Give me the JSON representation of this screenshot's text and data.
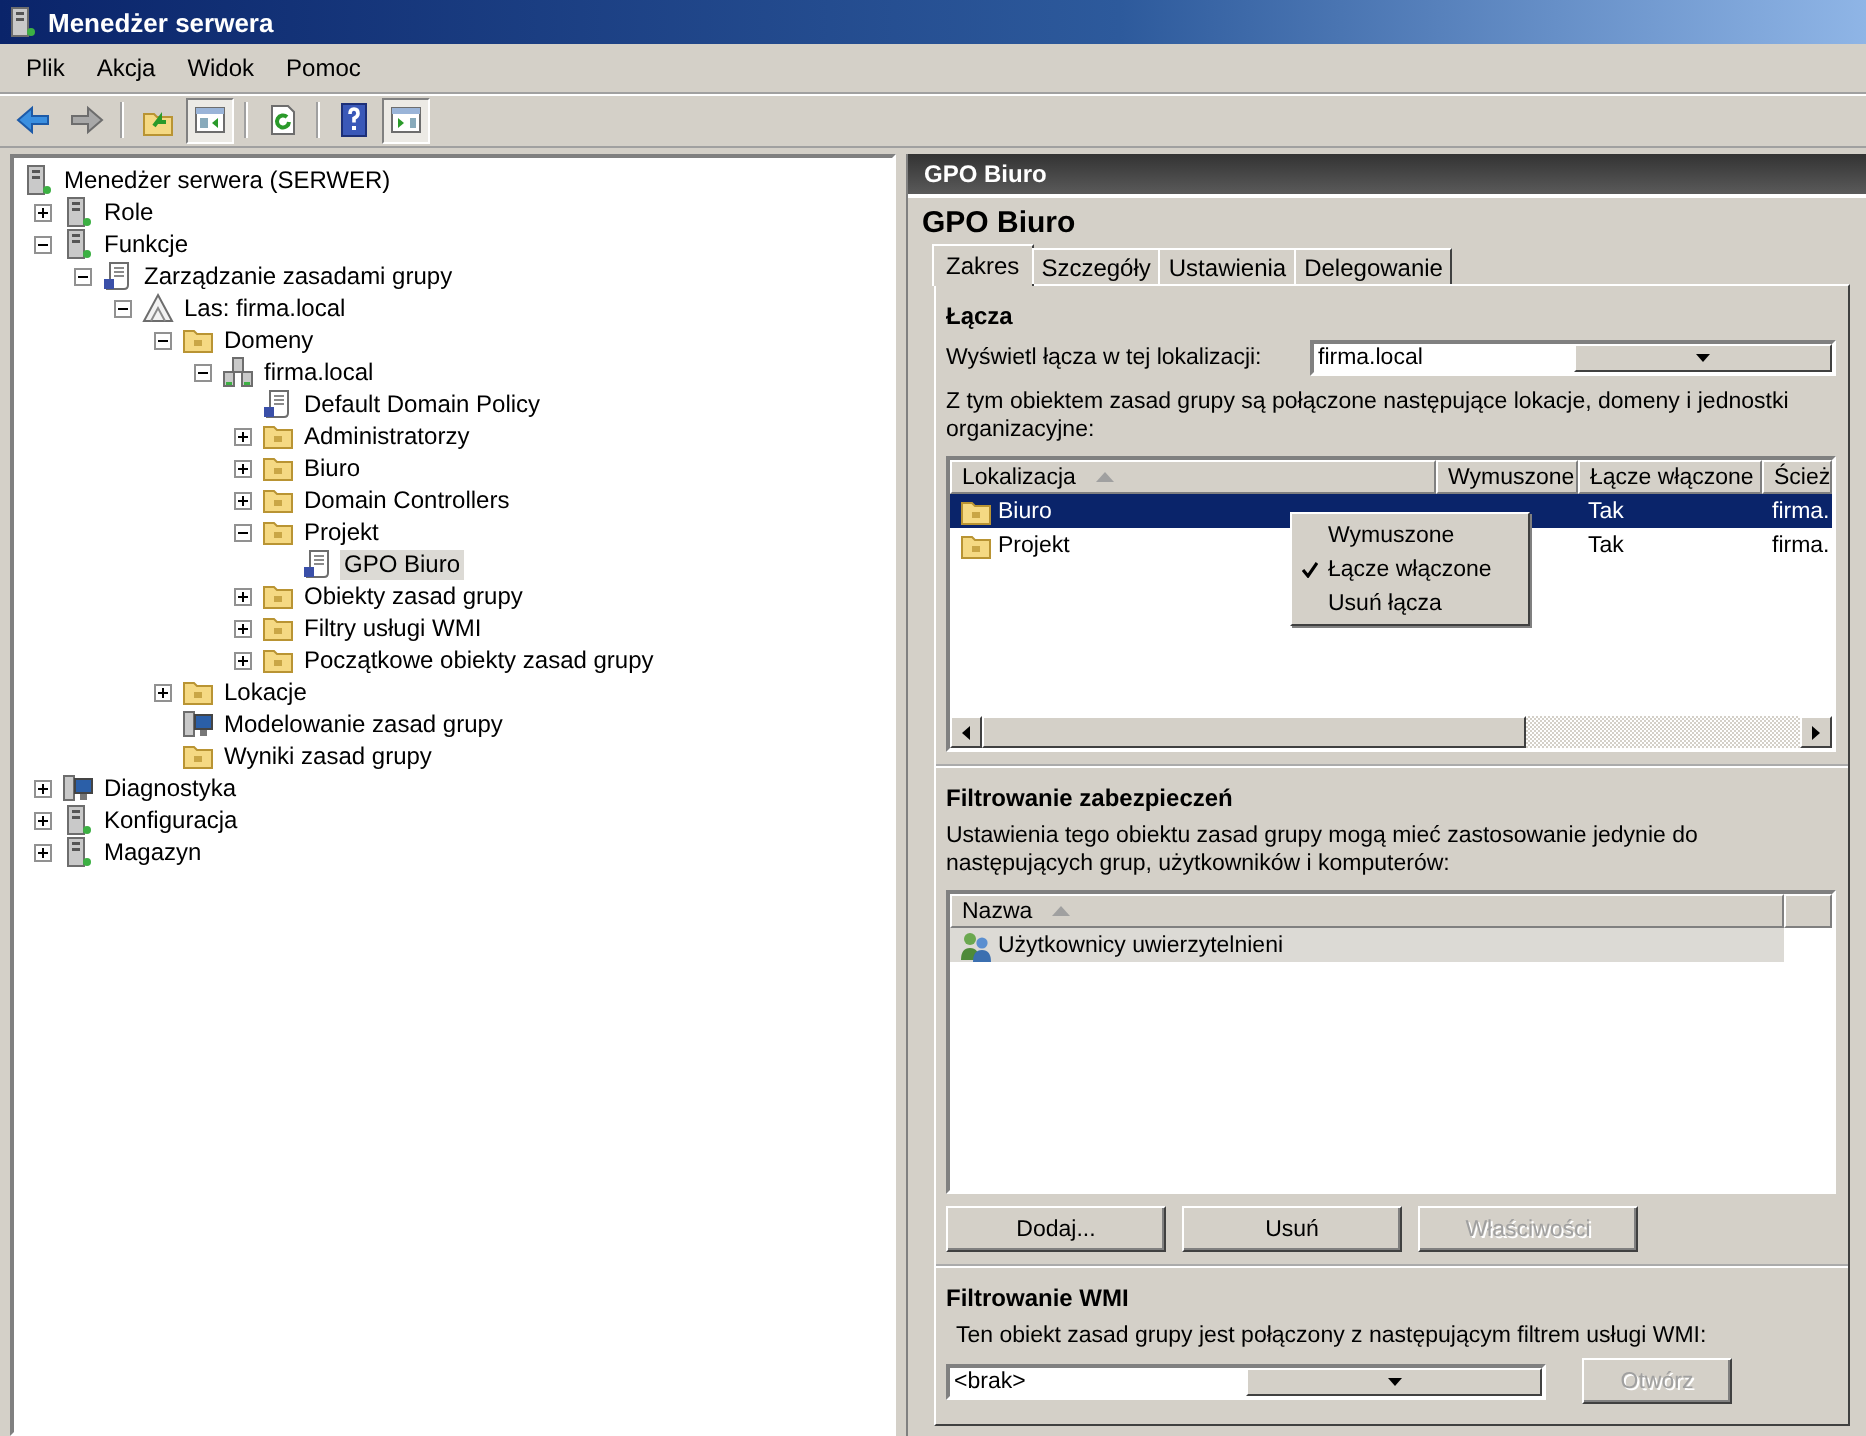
{
  "window": {
    "title": "Menedżer serwera"
  },
  "menu": [
    "Plik",
    "Akcja",
    "Widok",
    "Pomoc"
  ],
  "toolbar": [
    [
      {
        "kind": "back",
        "pressed": false
      },
      {
        "kind": "forward",
        "pressed": false
      }
    ],
    [
      {
        "kind": "up",
        "pressed": false
      },
      {
        "kind": "tree-pane",
        "pressed": true
      }
    ],
    [
      {
        "kind": "refresh",
        "pressed": false
      }
    ],
    [
      {
        "kind": "help",
        "pressed": false
      },
      {
        "kind": "action-pane",
        "pressed": true
      }
    ]
  ],
  "tree": {
    "root": {
      "label": "Menedżer serwera (SERWER)",
      "kind": "server",
      "selected": false
    },
    "items": [
      {
        "label": "Role",
        "kind": "server",
        "expanded": false,
        "selected": false
      },
      {
        "label": "Funkcje",
        "kind": "server",
        "expanded": true,
        "selected": false,
        "children": [
          {
            "label": "Zarządzanie zasadami grupy",
            "kind": "document",
            "expanded": true,
            "selected": false,
            "children": [
              {
                "label": "Las: firma.local",
                "kind": "forest",
                "expanded": true,
                "selected": false,
                "children": [
                  {
                    "label": "Domeny",
                    "kind": "folder",
                    "expanded": true,
                    "selected": false,
                    "children": [
                      {
                        "label": "firma.local",
                        "kind": "domain",
                        "expanded": true,
                        "selected": false,
                        "children": [
                          {
                            "label": "Default Domain Policy",
                            "kind": "document",
                            "selected": false
                          },
                          {
                            "label": "Administratorzy",
                            "kind": "folder",
                            "expanded": false,
                            "selected": false
                          },
                          {
                            "label": "Biuro",
                            "kind": "folder",
                            "expanded": false,
                            "selected": false
                          },
                          {
                            "label": "Domain Controllers",
                            "kind": "folder",
                            "expanded": false,
                            "selected": false
                          },
                          {
                            "label": "Projekt",
                            "kind": "folder",
                            "expanded": true,
                            "selected": false,
                            "children": [
                              {
                                "label": "GPO Biuro",
                                "kind": "document",
                                "selected": true
                              }
                            ]
                          },
                          {
                            "label": "Obiekty zasad grupy",
                            "kind": "folder",
                            "expanded": false,
                            "selected": false
                          },
                          {
                            "label": "Filtry usługi WMI",
                            "kind": "folder",
                            "expanded": false,
                            "selected": false
                          },
                          {
                            "label": "Początkowe obiekty zasad grupy",
                            "kind": "folder",
                            "expanded": false,
                            "selected": false
                          }
                        ]
                      }
                    ]
                  },
                  {
                    "label": "Lokacje",
                    "kind": "folder",
                    "expanded": false,
                    "selected": false
                  },
                  {
                    "label": "Modelowanie zasad grupy",
                    "kind": "monitor",
                    "selected": false
                  },
                  {
                    "label": "Wyniki zasad grupy",
                    "kind": "folder",
                    "selected": false
                  }
                ]
              }
            ]
          }
        ]
      },
      {
        "label": "Diagnostyka",
        "kind": "monitor",
        "expanded": false,
        "selected": false
      },
      {
        "label": "Konfiguracja",
        "kind": "server",
        "expanded": false,
        "selected": false
      },
      {
        "label": "Magazyn",
        "kind": "server",
        "expanded": false,
        "selected": false
      }
    ]
  },
  "details": {
    "header": "GPO Biuro",
    "title": "GPO Biuro",
    "tabs": [
      {
        "label": "Zakres",
        "selected": true
      },
      {
        "label": "Szczegóły",
        "selected": false
      },
      {
        "label": "Ustawienia",
        "selected": false
      },
      {
        "label": "Delegowanie",
        "selected": false
      }
    ],
    "links": {
      "heading": "Łącza",
      "location_label": "Wyświetl łącza w tej lokalizacji:",
      "location_value": "firma.local",
      "description": "Z tym obiektem zasad grupy są połączone następujące lokacje, domeny i jednostki organizacyjne:",
      "columns": [
        {
          "label": "Lokalizacja",
          "sorted": true
        },
        {
          "label": "Wymuszone",
          "sorted": false
        },
        {
          "label": "Łącze włączone",
          "sorted": false
        },
        {
          "label": "Ścież",
          "sorted": false
        }
      ],
      "rows": [
        {
          "location": "Biuro",
          "link_enabled": "Tak",
          "path": "firma.",
          "selected": true
        },
        {
          "location": "Projekt",
          "link_enabled": "Tak",
          "path": "firma.",
          "selected": false
        }
      ],
      "context_menu": [
        {
          "label": "Wymuszone",
          "checked": false
        },
        {
          "label": "Łącze włączone",
          "checked": true
        },
        {
          "label": "Usuń łącza",
          "checked": false
        }
      ]
    },
    "security": {
      "heading": "Filtrowanie zabezpieczeń",
      "description": "Ustawienia tego obiektu zasad grupy mogą mieć zastosowanie jedynie do następujących grup, użytkowników i komputerów:",
      "columns": [
        {
          "label": "Nazwa",
          "sorted": true
        }
      ],
      "rows": [
        {
          "name": "Użytkownicy uwierzytelnieni",
          "selected": true
        }
      ],
      "buttons": [
        {
          "label": "Dodaj...",
          "disabled": false
        },
        {
          "label": "Usuń",
          "disabled": false
        },
        {
          "label": "Właściwości",
          "disabled": true
        }
      ]
    },
    "wmi": {
      "heading": "Filtrowanie WMI",
      "description": "Ten obiekt zasad grupy jest połączony z następującym filtrem usługi WMI:",
      "value": "<brak>",
      "button": {
        "label": "Otwórz",
        "disabled": true
      }
    }
  }
}
